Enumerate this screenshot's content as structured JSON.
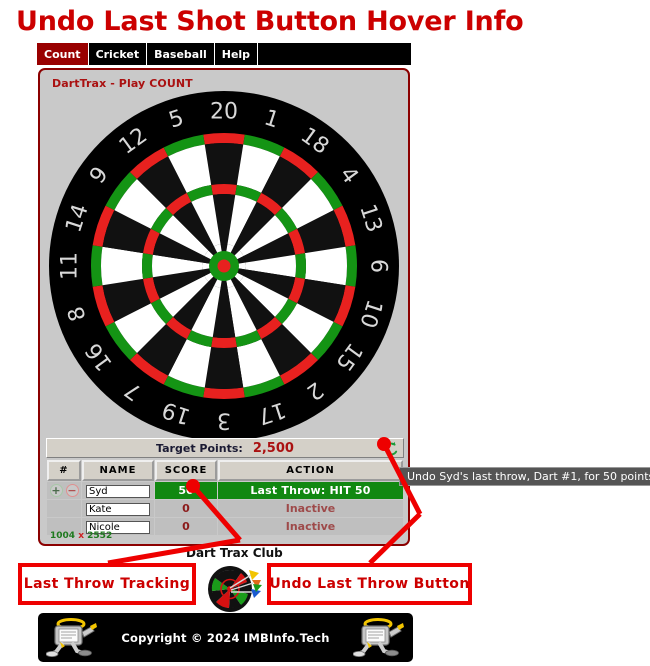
{
  "page": {
    "title": "Undo Last Shot Button Hover Info"
  },
  "tabs": [
    {
      "label": "Count",
      "active": true
    },
    {
      "label": "Cricket",
      "active": false
    },
    {
      "label": "Baseball",
      "active": false
    },
    {
      "label": "Help",
      "active": false
    }
  ],
  "app": {
    "heading": "DartTrax - Play COUNT",
    "dimensions": "1004 x 2552",
    "dimensions_sep": "x"
  },
  "scoreboard": {
    "target_label": "Target Points:",
    "target_value": "2,500",
    "undo_icon": "undo-circular-arrow-icon",
    "columns": [
      "#",
      "NAME",
      "SCORE",
      "ACTION"
    ],
    "rows": [
      {
        "name": "Syd",
        "score": "50",
        "action": "Last Throw: HIT 50",
        "active": true,
        "controls": [
          "+",
          "−"
        ]
      },
      {
        "name": "Kate",
        "score": "0",
        "action": "Inactive",
        "active": false,
        "controls": []
      },
      {
        "name": "Nicole",
        "score": "0",
        "action": "Inactive",
        "active": false,
        "controls": []
      }
    ]
  },
  "tooltip": {
    "text": "Undo Syd's last throw, Dart #1, for 50 points."
  },
  "annotations": [
    {
      "label": "Last Throw  Tracking"
    },
    {
      "label": "Undo Last Throw  Button"
    }
  ],
  "club": {
    "name": "Dart Trax Club",
    "logo_icon": "dartboard-with-darts-icon"
  },
  "footer": {
    "copyright": "Copyright © 2024 IMBInfo.Tech",
    "mascot_icon": "running-computer-mascot-icon"
  },
  "dartboard": {
    "numbers": [
      20,
      1,
      18,
      4,
      13,
      6,
      10,
      15,
      2,
      17,
      3,
      19,
      7,
      16,
      8,
      11,
      14,
      9,
      12,
      5
    ],
    "colors": {
      "ring_outer": "#000000",
      "segment_light": "#ffffff",
      "segment_dark": "#111111",
      "multiplier_red": "#e8211f",
      "multiplier_green": "#149414",
      "bull_outer": "#149414",
      "bull_inner": "#e8211f",
      "number_text": "#d8d8d8"
    }
  },
  "colors": {
    "accent_red": "#cc0000",
    "panel_border": "#8b0000",
    "panel_bg": "#c9c9c9",
    "active_row_green": "#118811",
    "tab_active": "#990000",
    "tooltip_bg": "#555555"
  }
}
